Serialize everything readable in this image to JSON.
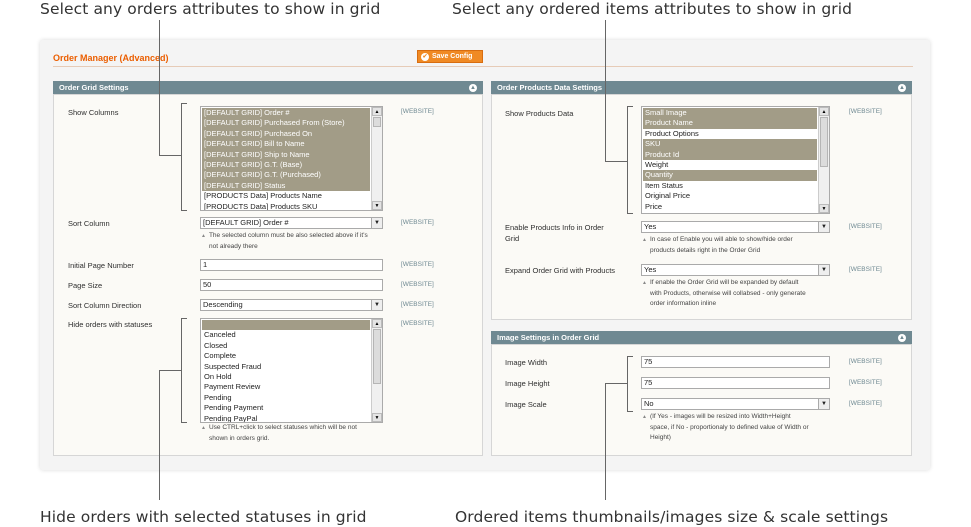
{
  "annotations": {
    "top_left": "Select any orders attributes to show in grid",
    "top_right": "Select any ordered items attributes to show in grid",
    "bottom_left": "Hide orders with selected statuses in grid",
    "bottom_right": "Ordered items thumbnails/images size & scale settings"
  },
  "page": {
    "title": "Order Manager (Advanced)",
    "save_label": "Save Config"
  },
  "scope": "[WEBSITE]",
  "grid_settings": {
    "header": "Order Grid Settings",
    "show_columns": {
      "label": "Show Columns",
      "options": [
        {
          "text": "[DEFAULT GRID] Order #",
          "selected": true
        },
        {
          "text": "[DEFAULT GRID] Purchased From (Store)",
          "selected": true
        },
        {
          "text": "[DEFAULT GRID] Purchased On",
          "selected": true
        },
        {
          "text": "[DEFAULT GRID] Bill to Name",
          "selected": true
        },
        {
          "text": "[DEFAULT GRID] Ship to Name",
          "selected": true
        },
        {
          "text": "[DEFAULT GRID] G.T. (Base)",
          "selected": true
        },
        {
          "text": "[DEFAULT GRID] G.T. (Purchased)",
          "selected": true
        },
        {
          "text": "[DEFAULT GRID] Status",
          "selected": true
        },
        {
          "text": "[PRODUCTS Data] Products Name",
          "selected": false
        },
        {
          "text": "[PRODUCTS Data] Products SKU",
          "selected": false
        }
      ]
    },
    "sort_column": {
      "label": "Sort Column",
      "value": "[DEFAULT GRID] Order #",
      "note_line1": "The selected column must be also selected above if it's",
      "note_line2": "not already there"
    },
    "initial_page": {
      "label": "Initial Page Number",
      "value": "1"
    },
    "page_size": {
      "label": "Page Size",
      "value": "50"
    },
    "sort_direction": {
      "label": "Sort Column Direction",
      "value": "Descending"
    },
    "hide_statuses": {
      "label": "Hide orders with statuses",
      "options": [
        {
          "text": "",
          "selected": true
        },
        {
          "text": "Canceled",
          "selected": false
        },
        {
          "text": "Closed",
          "selected": false
        },
        {
          "text": "Complete",
          "selected": false
        },
        {
          "text": "Suspected Fraud",
          "selected": false
        },
        {
          "text": "On Hold",
          "selected": false
        },
        {
          "text": "Payment Review",
          "selected": false
        },
        {
          "text": "Pending",
          "selected": false
        },
        {
          "text": "Pending Payment",
          "selected": false
        },
        {
          "text": "Pending PayPal",
          "selected": false
        }
      ],
      "note_line1": "Use CTRL+click to select statuses which will be not",
      "note_line2": "shown in orders grid."
    }
  },
  "products_settings": {
    "header": "Order Products Data Settings",
    "show_products": {
      "label": "Show Products Data",
      "options": [
        {
          "text": "Small Image",
          "selected": true
        },
        {
          "text": "Product Name",
          "selected": true
        },
        {
          "text": "Product Options",
          "selected": false
        },
        {
          "text": "SKU",
          "selected": true
        },
        {
          "text": "Product Id",
          "selected": true
        },
        {
          "text": "Weight",
          "selected": false
        },
        {
          "text": "Quantity",
          "selected": true
        },
        {
          "text": "Item Status",
          "selected": false
        },
        {
          "text": "Original Price",
          "selected": false
        },
        {
          "text": "Price",
          "selected": false
        }
      ]
    },
    "enable_info": {
      "label_line1": "Enable Products Info in Order",
      "label_line2": "Grid",
      "value": "Yes",
      "note_line1": "In case of Enable you will able to show/hide order",
      "note_line2": "products details right in the Order Grid"
    },
    "expand_grid": {
      "label": "Expand Order Grid with Products",
      "value": "Yes",
      "note_line1": "If enable the Order Grid will be expanded by default",
      "note_line2": "with Products, otherwise will collabsed - only generate",
      "note_line3": "order information inline"
    }
  },
  "image_settings": {
    "header": "Image Settings in Order Grid",
    "width": {
      "label": "Image Width",
      "value": "75"
    },
    "height": {
      "label": "Image Height",
      "value": "75"
    },
    "scale": {
      "label": "Image Scale",
      "value": "No",
      "note_line1": "(If Yes - images will be resized into Width+Height",
      "note_line2": "space, if No - proportionaly to defined value of Width or",
      "note_line3": "Height)"
    }
  }
}
